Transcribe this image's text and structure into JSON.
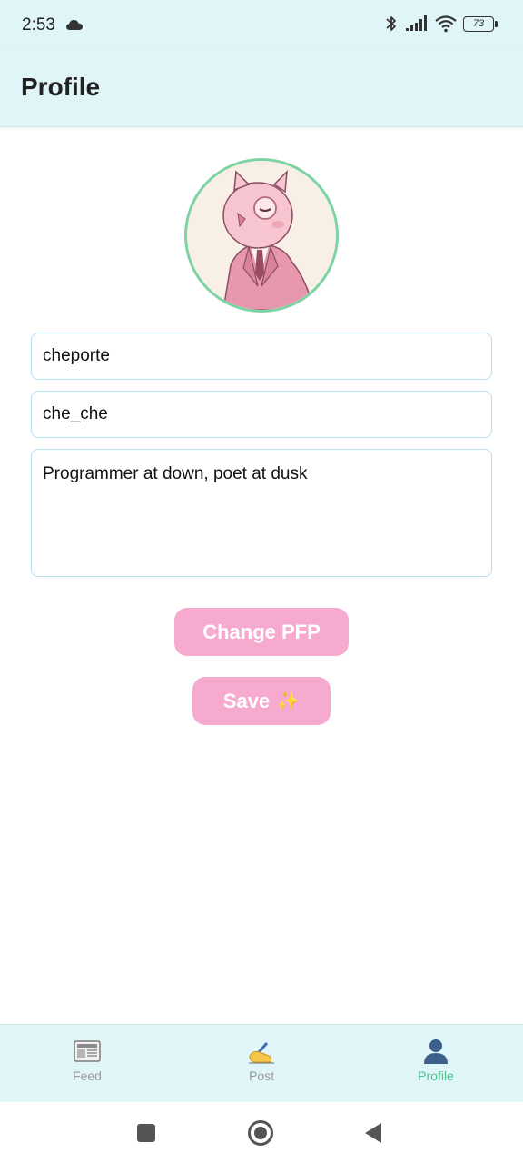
{
  "status_bar": {
    "time": "2:53",
    "battery": "73"
  },
  "header": {
    "title": "Profile"
  },
  "profile": {
    "username": "cheporte",
    "handle": "che_che",
    "bio": "Programmer at down, poet at dusk"
  },
  "buttons": {
    "change_pfp": "Change PFP",
    "save": "Save",
    "save_emoji": "✨"
  },
  "bottom_nav": {
    "items": [
      {
        "label": "Feed",
        "icon": "newspaper-icon"
      },
      {
        "label": "Post",
        "icon": "writing-hand-icon"
      },
      {
        "label": "Profile",
        "icon": "person-icon"
      }
    ],
    "active": "Profile"
  },
  "colors": {
    "header_bg": "#e0f5f7",
    "button_bg": "#f7aacf",
    "active_tab": "#49c48f",
    "avatar_border": "#7ed3a4",
    "field_border": "#b4e0ec"
  }
}
